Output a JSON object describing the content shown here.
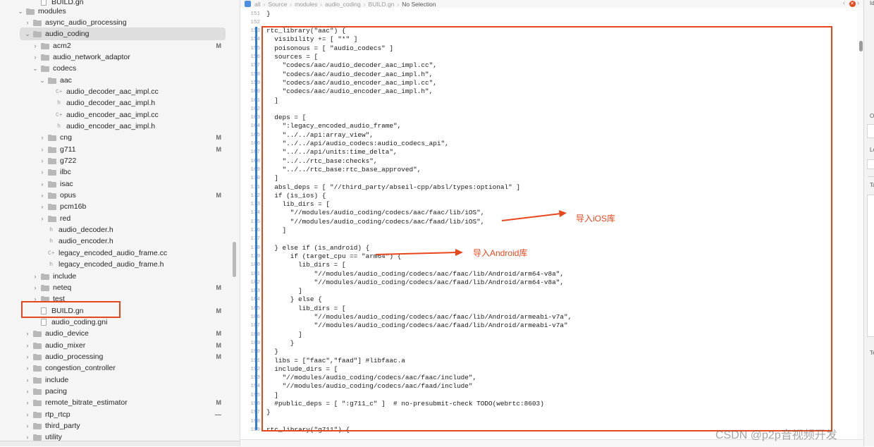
{
  "jumpbar": {
    "crumbs": [
      "all",
      "Source",
      "modules",
      "audio_coding",
      "BUILD.gn"
    ],
    "last": "No Selection"
  },
  "sidebar": {
    "items": [
      {
        "label": "BUILD.gn",
        "level": 3,
        "kind": "file",
        "disc": "",
        "badge": ""
      },
      {
        "label": "modules",
        "level": 1,
        "kind": "folder",
        "disc": "open",
        "badge": ""
      },
      {
        "label": "async_audio_processing",
        "level": 2,
        "kind": "folder",
        "disc": "closed",
        "badge": ""
      },
      {
        "label": "audio_coding",
        "level": 2,
        "kind": "folder",
        "disc": "open",
        "badge": "",
        "selected": true
      },
      {
        "label": "acm2",
        "level": 3,
        "kind": "folder",
        "disc": "closed",
        "badge": "M"
      },
      {
        "label": "audio_network_adaptor",
        "level": 3,
        "kind": "folder",
        "disc": "closed",
        "badge": ""
      },
      {
        "label": "codecs",
        "level": 3,
        "kind": "folder",
        "disc": "open",
        "badge": ""
      },
      {
        "label": "aac",
        "level": 4,
        "kind": "folder",
        "disc": "open",
        "badge": ""
      },
      {
        "label": "audio_decoder_aac_impl.cc",
        "level": 5,
        "kind": "cc",
        "disc": "",
        "badge": ""
      },
      {
        "label": "audio_decoder_aac_impl.h",
        "level": 5,
        "kind": "h",
        "disc": "",
        "badge": ""
      },
      {
        "label": "audio_encoder_aac_impl.cc",
        "level": 5,
        "kind": "cc",
        "disc": "",
        "badge": ""
      },
      {
        "label": "audio_encoder_aac_impl.h",
        "level": 5,
        "kind": "h",
        "disc": "",
        "badge": ""
      },
      {
        "label": "cng",
        "level": 4,
        "kind": "folder",
        "disc": "closed",
        "badge": "M"
      },
      {
        "label": "g711",
        "level": 4,
        "kind": "folder",
        "disc": "closed",
        "badge": "M"
      },
      {
        "label": "g722",
        "level": 4,
        "kind": "folder",
        "disc": "closed",
        "badge": ""
      },
      {
        "label": "ilbc",
        "level": 4,
        "kind": "folder",
        "disc": "closed",
        "badge": ""
      },
      {
        "label": "isac",
        "level": 4,
        "kind": "folder",
        "disc": "closed",
        "badge": ""
      },
      {
        "label": "opus",
        "level": 4,
        "kind": "folder",
        "disc": "closed",
        "badge": "M"
      },
      {
        "label": "pcm16b",
        "level": 4,
        "kind": "folder",
        "disc": "closed",
        "badge": ""
      },
      {
        "label": "red",
        "level": 4,
        "kind": "folder",
        "disc": "closed",
        "badge": ""
      },
      {
        "label": "audio_decoder.h",
        "level": 4,
        "kind": "h",
        "disc": "",
        "badge": ""
      },
      {
        "label": "audio_encoder.h",
        "level": 4,
        "kind": "h",
        "disc": "",
        "badge": ""
      },
      {
        "label": "legacy_encoded_audio_frame.cc",
        "level": 4,
        "kind": "cc",
        "disc": "",
        "badge": ""
      },
      {
        "label": "legacy_encoded_audio_frame.h",
        "level": 4,
        "kind": "h",
        "disc": "",
        "badge": ""
      },
      {
        "label": "include",
        "level": 3,
        "kind": "folder",
        "disc": "closed",
        "badge": ""
      },
      {
        "label": "neteq",
        "level": 3,
        "kind": "folder",
        "disc": "closed",
        "badge": "M"
      },
      {
        "label": "test",
        "level": 3,
        "kind": "folder",
        "disc": "closed",
        "badge": ""
      },
      {
        "label": "BUILD.gn",
        "level": 3,
        "kind": "file",
        "disc": "",
        "badge": "M"
      },
      {
        "label": "audio_coding.gni",
        "level": 3,
        "kind": "file",
        "disc": "",
        "badge": ""
      },
      {
        "label": "audio_device",
        "level": 2,
        "kind": "folder",
        "disc": "closed",
        "badge": "M"
      },
      {
        "label": "audio_mixer",
        "level": 2,
        "kind": "folder",
        "disc": "closed",
        "badge": "M"
      },
      {
        "label": "audio_processing",
        "level": 2,
        "kind": "folder",
        "disc": "closed",
        "badge": "M"
      },
      {
        "label": "congestion_controller",
        "level": 2,
        "kind": "folder",
        "disc": "closed",
        "badge": ""
      },
      {
        "label": "include",
        "level": 2,
        "kind": "folder",
        "disc": "closed",
        "badge": ""
      },
      {
        "label": "pacing",
        "level": 2,
        "kind": "folder",
        "disc": "closed",
        "badge": ""
      },
      {
        "label": "remote_bitrate_estimator",
        "level": 2,
        "kind": "folder",
        "disc": "closed",
        "badge": "M"
      },
      {
        "label": "rtp_rtcp",
        "level": 2,
        "kind": "folder",
        "disc": "closed",
        "badge": "—"
      },
      {
        "label": "third_party",
        "level": 2,
        "kind": "folder",
        "disc": "closed",
        "badge": ""
      },
      {
        "label": "utility",
        "level": 2,
        "kind": "folder",
        "disc": "closed",
        "badge": ""
      }
    ]
  },
  "editor": {
    "first_line": 151,
    "lines": [
      "}",
      "",
      "rtc_library(\"aac\") {",
      "  visibility += [ \"*\" ]",
      "  poisonous = [ \"audio_codecs\" ]",
      "  sources = [",
      "    \"codecs/aac/audio_decoder_aac_impl.cc\",",
      "    \"codecs/aac/audio_decoder_aac_impl.h\",",
      "    \"codecs/aac/audio_encoder_aac_impl.cc\",",
      "    \"codecs/aac/audio_encoder_aac_impl.h\",",
      "  ]",
      "",
      "  deps = [",
      "    \":legacy_encoded_audio_frame\",",
      "    \"../../api:array_view\",",
      "    \"../../api/audio_codecs:audio_codecs_api\",",
      "    \"../../api/units:time_delta\",",
      "    \"../../rtc_base:checks\",",
      "    \"../../rtc_base:rtc_base_approved\",",
      "  ]",
      "  absl_deps = [ \"//third_party/abseil-cpp/absl/types:optional\" ]",
      "  if (is_ios) {",
      "    lib_dirs = [",
      "      \"//modules/audio_coding/codecs/aac/faac/lib/iOS\",",
      "      \"//modules/audio_coding/codecs/aac/faad/lib/iOS\",",
      "    ]",
      "",
      "  } else if (is_android) {",
      "      if (target_cpu == \"arm64\") {",
      "        lib_dirs = [",
      "            \"//modules/audio_coding/codecs/aac/faac/lib/Android/arm64-v8a\",",
      "            \"//modules/audio_coding/codecs/aac/faad/lib/Android/arm64-v8a\",",
      "        ]",
      "      } else {",
      "        lib_dirs = [",
      "            \"//modules/audio_coding/codecs/aac/faac/lib/Android/armeabi-v7a\",",
      "            \"//modules/audio_coding/codecs/aac/faad/lib/Android/armeabi-v7a\"",
      "        ]",
      "      }",
      "  }",
      "  libs = [\"faac\",\"faad\"] #libfaac.a",
      "  include_dirs = [",
      "    \"//modules/audio_coding/codecs/aac/faac/include\",",
      "    \"//modules/audio_coding/codecs/aac/faad/include\"",
      "  ]",
      "  #public_deps = [ \":g711_c\" ]  # no-presubmit-check TODO(webrtc:8603)",
      "}",
      "",
      "rtc_library(\"g711\") {"
    ]
  },
  "annotations": {
    "ios": "导入iOS库",
    "android": "导入Android库"
  },
  "inspector": {
    "letters": [
      "Id",
      "O",
      "Lo",
      "Ta",
      "Te"
    ]
  },
  "watermark": "CSDN @p2p音视频开发",
  "colors": {
    "highlight": "#e8471c",
    "change_bar": "#2f7de1"
  }
}
